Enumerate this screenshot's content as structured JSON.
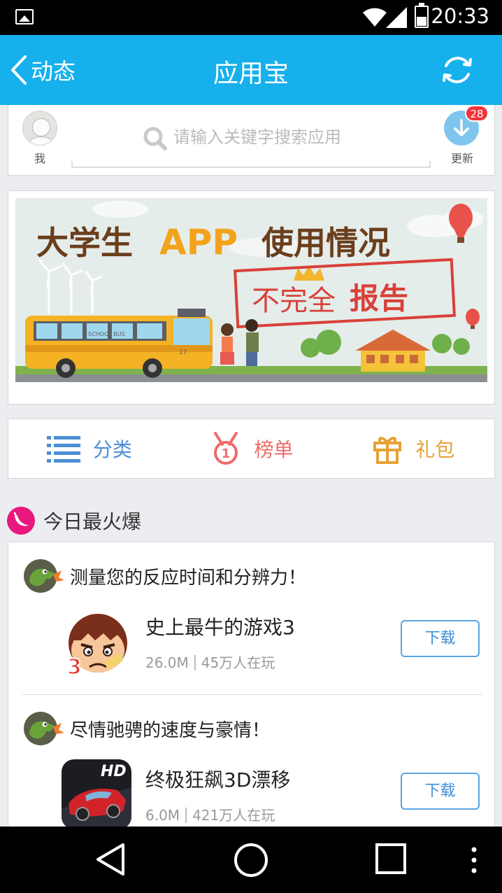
{
  "status_bar": {
    "time": "20:33",
    "icons": [
      "image-icon",
      "wifi-icon",
      "signal-icon",
      "battery-icon"
    ]
  },
  "title_bar": {
    "back_label": "动态",
    "title": "应用宝",
    "refresh_icon": "refresh-icon"
  },
  "search": {
    "me_label": "我",
    "placeholder": "请输入关键字搜索应用",
    "update_label": "更新",
    "update_count": "28"
  },
  "banner": {
    "title_prefix": "大学生",
    "title_app": "APP",
    "title_suffix": "使用情况",
    "stamp_plain": "不完全",
    "stamp_bold": "报告",
    "bus_sign": "SCHOOL BUS",
    "bus_number": "17"
  },
  "quick_nav": [
    {
      "label": "分类",
      "icon": "list-icon"
    },
    {
      "label": "榜单",
      "icon": "medal-icon"
    },
    {
      "label": "礼包",
      "icon": "gift-icon"
    }
  ],
  "section": {
    "title": "今日最火爆",
    "icon": "pepper-icon"
  },
  "recommendations": [
    {
      "tagline": "测量您的反应时间和分辨力！",
      "app_name": "史上最牛的游戏3",
      "size": "26.0M",
      "players": "45万人在玩",
      "button": "下载",
      "icon_badge": "3"
    },
    {
      "tagline": "尽情驰骋的速度与豪情！",
      "app_name": "终极狂飙3D漂移",
      "size": "6.0M",
      "players": "421万人在玩",
      "button": "下载",
      "icon_badge": "HD"
    }
  ],
  "colors": {
    "accent": "#16b0ec",
    "category": "#4b8fd5",
    "rank": "#f06a6a",
    "gift": "#e6a236",
    "pepper": "#e8187e",
    "badge": "#f1343c"
  }
}
